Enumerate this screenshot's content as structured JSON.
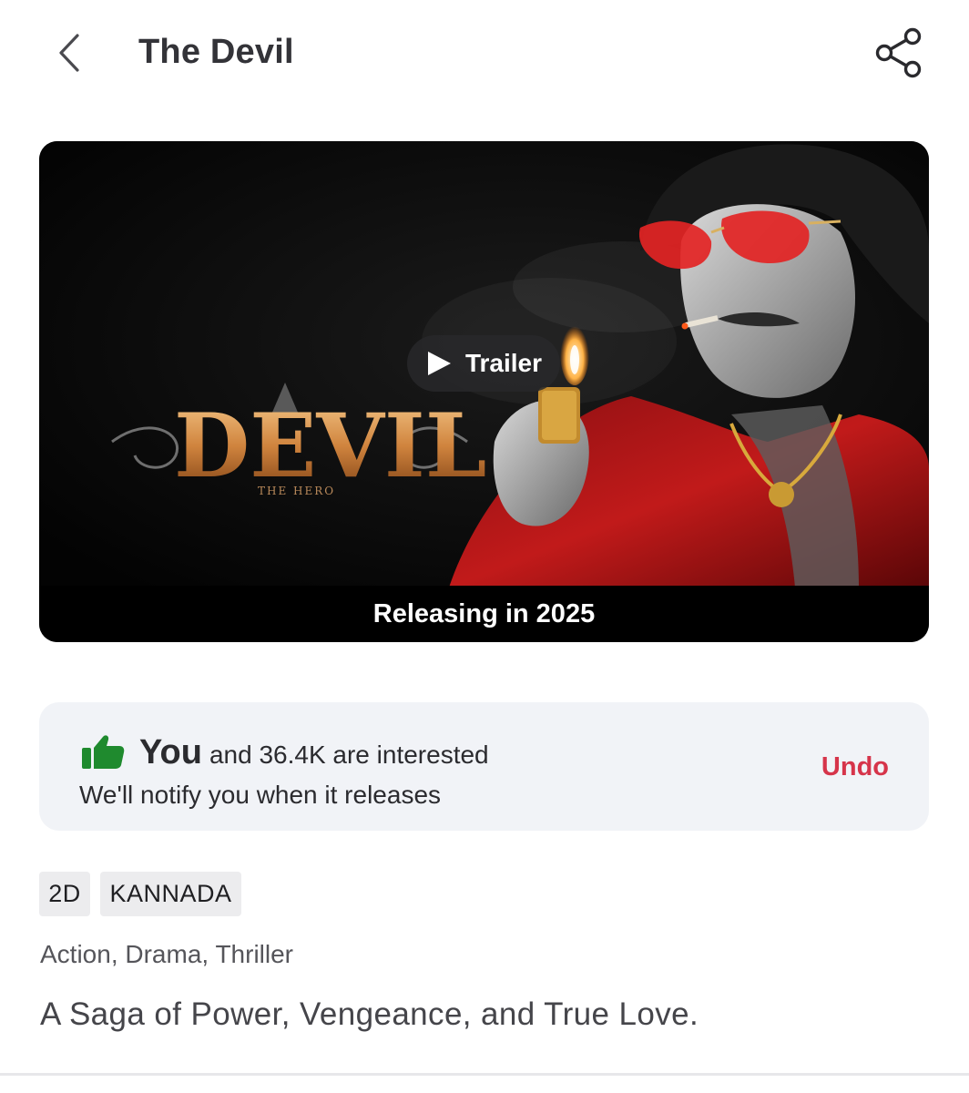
{
  "header": {
    "title": "The Devil",
    "back_icon": "chevron-left-icon",
    "share_icon": "share-icon"
  },
  "media": {
    "poster_title": "DEVIL",
    "poster_subtitle": "THE HERO",
    "trailer_label": "Trailer",
    "release_text": "Releasing in 2025",
    "play_icon": "play-icon"
  },
  "interest": {
    "you_label": "You",
    "count_text": "and 36.4K are interested",
    "notify_text": "We'll notify you when it releases",
    "undo_label": "Undo",
    "thumb_icon": "thumbs-up-icon",
    "thumb_color": "#1f8a2e",
    "undo_color": "#d6344a"
  },
  "tags": [
    "2D",
    "KANNADA"
  ],
  "genres": "Action, Drama, Thriller",
  "tagline": "A Saga of Power, Vengeance, and True Love."
}
